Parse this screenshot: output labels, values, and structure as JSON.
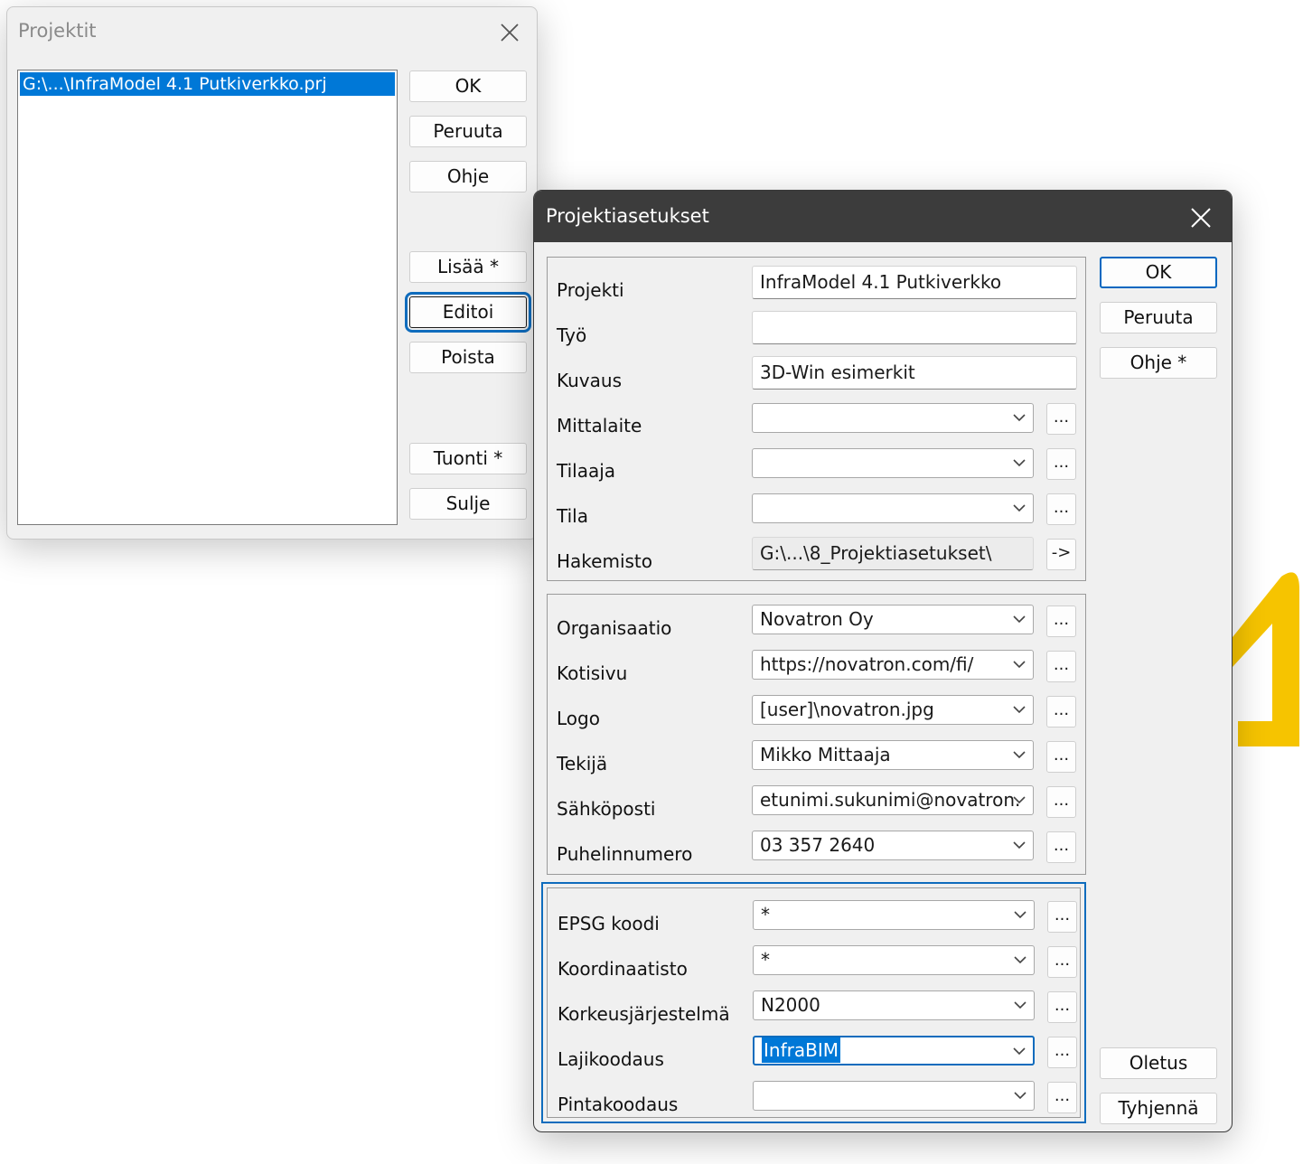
{
  "projects_dialog": {
    "title": "Projektit",
    "list_items": [
      "G:\\...\\InfraModel 4.1 Putkiverkko.prj"
    ],
    "buttons": {
      "ok": "OK",
      "cancel": "Peruuta",
      "help": "Ohje",
      "add": "Lisää *",
      "edit": "Editoi",
      "delete": "Poista",
      "import": "Tuonti *",
      "close": "Sulje"
    }
  },
  "settings_dialog": {
    "title": "Projektiasetukset",
    "buttons": {
      "ok": "OK",
      "cancel": "Peruuta",
      "help": "Ohje *",
      "default": "Oletus",
      "clear": "Tyhjennä",
      "browse": "...",
      "go": "->"
    },
    "project_group": {
      "projekti": {
        "label": "Projekti",
        "value": "InfraModel 4.1 Putkiverkko"
      },
      "tyo": {
        "label": "Työ",
        "value": ""
      },
      "kuvaus": {
        "label": "Kuvaus",
        "value": "3D-Win esimerkit"
      },
      "mittalaite": {
        "label": "Mittalaite",
        "value": ""
      },
      "tilaaja": {
        "label": "Tilaaja",
        "value": ""
      },
      "tila": {
        "label": "Tila",
        "value": ""
      },
      "hakemisto": {
        "label": "Hakemisto",
        "value": "G:\\...\\8_Projektiasetukset\\"
      }
    },
    "org_group": {
      "organisaatio": {
        "label": "Organisaatio",
        "value": "Novatron Oy"
      },
      "kotisivu": {
        "label": "Kotisivu",
        "value": "https://novatron.com/fi/"
      },
      "logo": {
        "label": "Logo",
        "value": "[user]\\novatron.jpg"
      },
      "tekija": {
        "label": "Tekijä",
        "value": "Mikko Mittaaja"
      },
      "sahkoposti": {
        "label": "Sähköposti",
        "value": "etunimi.sukunimi@novatron."
      },
      "puhelin": {
        "label": "Puhelinnumero",
        "value": "03 357 2640"
      }
    },
    "coord_group": {
      "epsg": {
        "label": "EPSG koodi",
        "value": "*"
      },
      "koordinaatisto": {
        "label": "Koordinaatisto",
        "value": "*"
      },
      "korkeus": {
        "label": "Korkeusjärjestelmä",
        "value": "N2000"
      },
      "lajikoodaus": {
        "label": "Lajikoodaus",
        "value": "InfraBIM"
      },
      "pintakoodaus": {
        "label": "Pintakoodaus",
        "value": ""
      }
    }
  },
  "colors": {
    "selection": "#0078d7",
    "focus": "#0f6cbd",
    "titlebar_dark": "#3c3c3c",
    "logo_yellow": "#f6c400"
  }
}
